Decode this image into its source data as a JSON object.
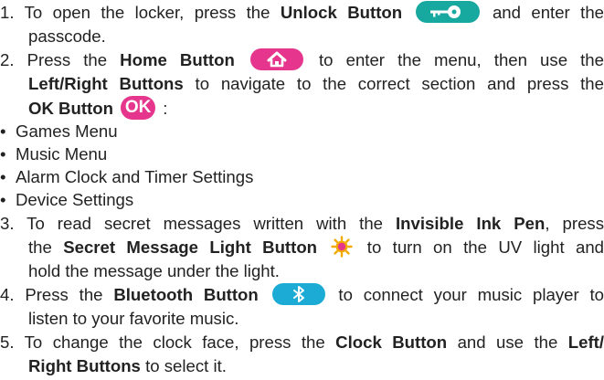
{
  "items": [
    {
      "line1": {
        "pre": "1. To open the locker, press the ",
        "bold": "Unlock Button",
        "post": " and enter the"
      },
      "line2": "passcode."
    },
    {
      "line1": {
        "pre": "2. Press the ",
        "bold": "Home Button",
        "post": " to enter the menu, then use the"
      },
      "line2": {
        "bold": "Left/Right Buttons",
        "post": " to navigate to the correct section and press the"
      },
      "line3": {
        "bold": "OK Button",
        "ok_label": "OK",
        "post": " :"
      }
    }
  ],
  "bullets": [
    "Games Menu",
    "Music Menu",
    "Alarm Clock and Timer Settings",
    "Device Settings"
  ],
  "bullet_char": "•",
  "item3": {
    "line1": {
      "pre": "3. To read secret messages written with the ",
      "bold": "Invisible Ink Pen",
      "post": ", press"
    },
    "line2": {
      "pre": "the ",
      "bold": "Secret Message Light Button",
      "post": " to turn on the UV light and"
    },
    "line3": "hold the message under the light."
  },
  "item4": {
    "line1": {
      "pre": "4. Press the ",
      "bold": "Bluetooth Button",
      "post": " to connect your music player to"
    },
    "line2": "listen to your favorite music."
  },
  "item5": {
    "line1": {
      "pre": "5. To change the clock face, press the ",
      "bold": "Clock Button",
      "mid": " and use the ",
      "bold2": "Left/"
    },
    "line2": {
      "bold": "Right Buttons",
      "post": " to select it."
    }
  },
  "colors": {
    "unlock": "#17a8a0",
    "home": "#e6358d",
    "ok": "#e6358d",
    "bluetooth": "#1cabd4",
    "sun": "#f2a900"
  },
  "icons": {
    "unlock": "key-icon",
    "home": "home-icon",
    "secret": "uv-light-icon",
    "bluetooth": "bluetooth-icon"
  }
}
